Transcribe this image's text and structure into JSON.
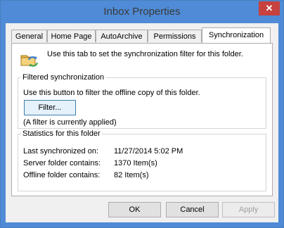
{
  "window": {
    "title": "Inbox Properties",
    "close_glyph": "✕"
  },
  "tabs": [
    {
      "label": "General"
    },
    {
      "label": "Home Page"
    },
    {
      "label": "AutoArchive"
    },
    {
      "label": "Permissions"
    },
    {
      "label": "Synchronization"
    }
  ],
  "active_tab": "Synchronization",
  "intro_text": "Use this tab to set the synchronization filter for this folder.",
  "filtered_sync": {
    "title": "Filtered synchronization",
    "description": "Use this button to filter the offline copy of this folder.",
    "filter_button": "Filter...",
    "status": "(A filter is currently applied)"
  },
  "statistics": {
    "title": "Statistics for this folder",
    "rows": [
      {
        "label": "Last synchronized on:",
        "value": "11/27/2014 5:02 PM"
      },
      {
        "label": "Server folder contains:",
        "value": "1370 Item(s)"
      },
      {
        "label": "Offline folder contains:",
        "value": "82 Item(s)"
      }
    ]
  },
  "buttons": {
    "ok": "OK",
    "cancel": "Cancel",
    "apply": "Apply"
  },
  "colors": {
    "frame": "#4f8bd6",
    "close": "#c7413f",
    "dialog_bg": "#f0f0f0"
  },
  "icons": {
    "title_icon": "sync-folder-icon"
  }
}
